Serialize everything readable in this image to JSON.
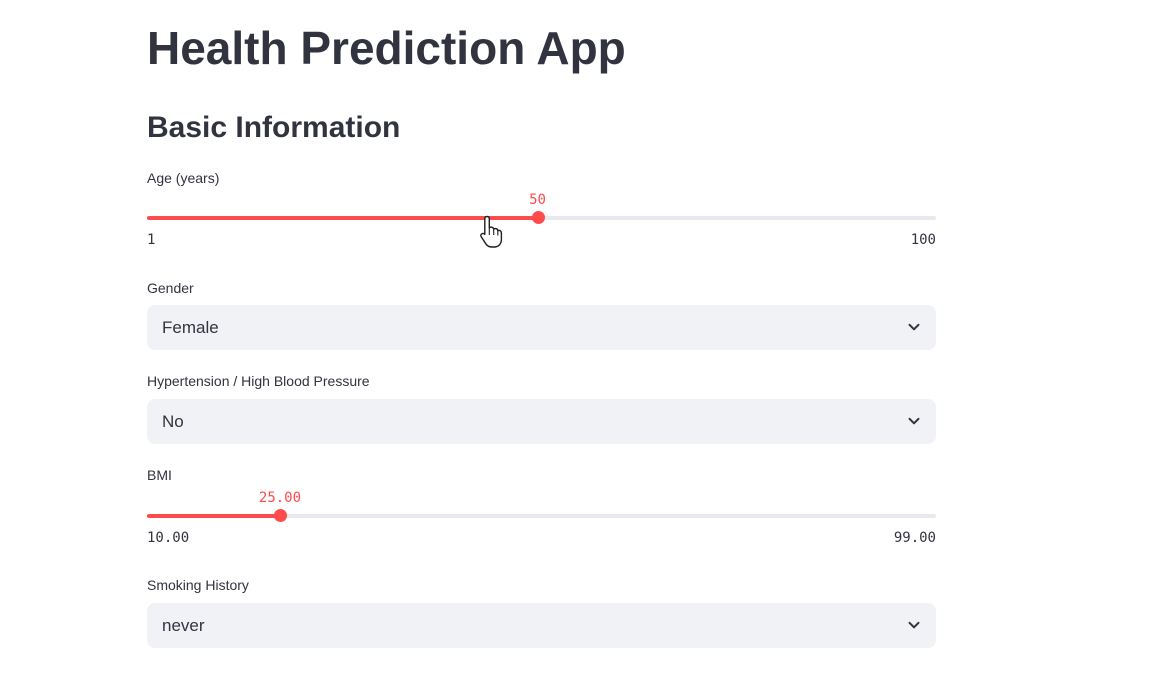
{
  "app": {
    "title": "Health Prediction App"
  },
  "section": {
    "title": "Basic Information"
  },
  "age": {
    "label": "Age (years)",
    "value": "50",
    "value_num": 50,
    "min": "1",
    "min_num": 1,
    "max": "100",
    "max_num": 100
  },
  "gender": {
    "label": "Gender",
    "selected": "Female",
    "icon": "chevron-down-icon"
  },
  "hypertension": {
    "label": "Hypertension / High Blood Pressure",
    "selected": "No",
    "icon": "chevron-down-icon"
  },
  "bmi": {
    "label": "BMI",
    "value": "25.00",
    "value_num": 25,
    "min": "10.00",
    "min_num": 10,
    "max": "99.00",
    "max_num": 99
  },
  "smoking": {
    "label": "Smoking History",
    "selected": "never",
    "icon": "chevron-down-icon"
  },
  "colors": {
    "accent": "#ff4b4b",
    "track": "#e8e9ee",
    "select_background": "#f0f2f6",
    "text": "#31333f"
  }
}
